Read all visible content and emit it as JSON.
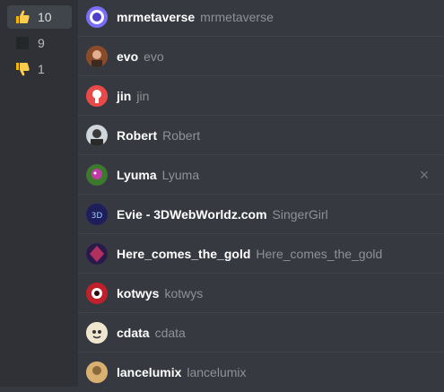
{
  "reactions": [
    {
      "emoji": "thumbs-up-icon",
      "count": "10",
      "selected": true
    },
    {
      "emoji": "blank-emoji-icon",
      "count": "9",
      "selected": false
    },
    {
      "emoji": "thumbs-down-icon",
      "count": "1",
      "selected": false
    }
  ],
  "users": [
    {
      "name": "mrmetaverse",
      "tag": "mrmetaverse",
      "avatar_color": "#7b6ef6"
    },
    {
      "name": "evo",
      "tag": "evo",
      "avatar_color": "#a05a2c"
    },
    {
      "name": "jin",
      "tag": "jin",
      "avatar_color": "#e84a4a"
    },
    {
      "name": "Robert",
      "tag": "Robert",
      "avatar_color": "#5b6b7a"
    },
    {
      "name": "Lyuma",
      "tag": "Lyuma",
      "avatar_color": "#7c2d8f"
    },
    {
      "name": "Evie - 3DWebWorldz.com",
      "tag": "SingerGirl",
      "avatar_color": "#2a2a7a"
    },
    {
      "name": "Here_comes_the_gold",
      "tag": "Here_comes_the_gold",
      "avatar_color": "#4a3a8a"
    },
    {
      "name": "kotwys",
      "tag": "kotwys",
      "avatar_color": "#c0202a"
    },
    {
      "name": "cdata",
      "tag": "cdata",
      "avatar_color": "#f0e6d0"
    },
    {
      "name": "lancelumix",
      "tag": "lancelumix",
      "avatar_color": "#d8b070"
    }
  ],
  "close_label": "×",
  "colors": {
    "accent": "#5865f2",
    "background": "#36393f",
    "sidebar": "#2f3136"
  }
}
